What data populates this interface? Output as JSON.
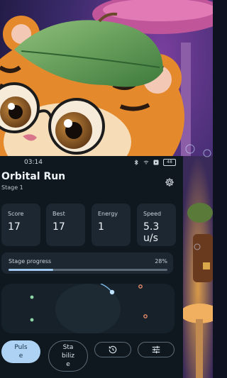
{
  "status_bar": {
    "time": "03:14",
    "battery": "48"
  },
  "header": {
    "title": "Orbital Run",
    "subtitle": "Stage 1"
  },
  "stats": [
    {
      "label": "Score",
      "value": "17"
    },
    {
      "label": "Best",
      "value": "17"
    },
    {
      "label": "Energy",
      "value": "1"
    },
    {
      "label": "Speed",
      "value": "5.3 u/s"
    }
  ],
  "progress": {
    "label": "Stage progress",
    "value_text": "28%",
    "fraction": 0.28
  },
  "controls": {
    "pulse_label": "Puls e",
    "stabilize_label": "Sta biliz e"
  },
  "icons": [
    "gear-icon",
    "history-icon",
    "tune-icon",
    "bluetooth-icon",
    "wifi-icon",
    "battery-icon"
  ],
  "colors": {
    "accent": "#aed2f3",
    "panel": "#10181f",
    "card": "#1c2732"
  }
}
